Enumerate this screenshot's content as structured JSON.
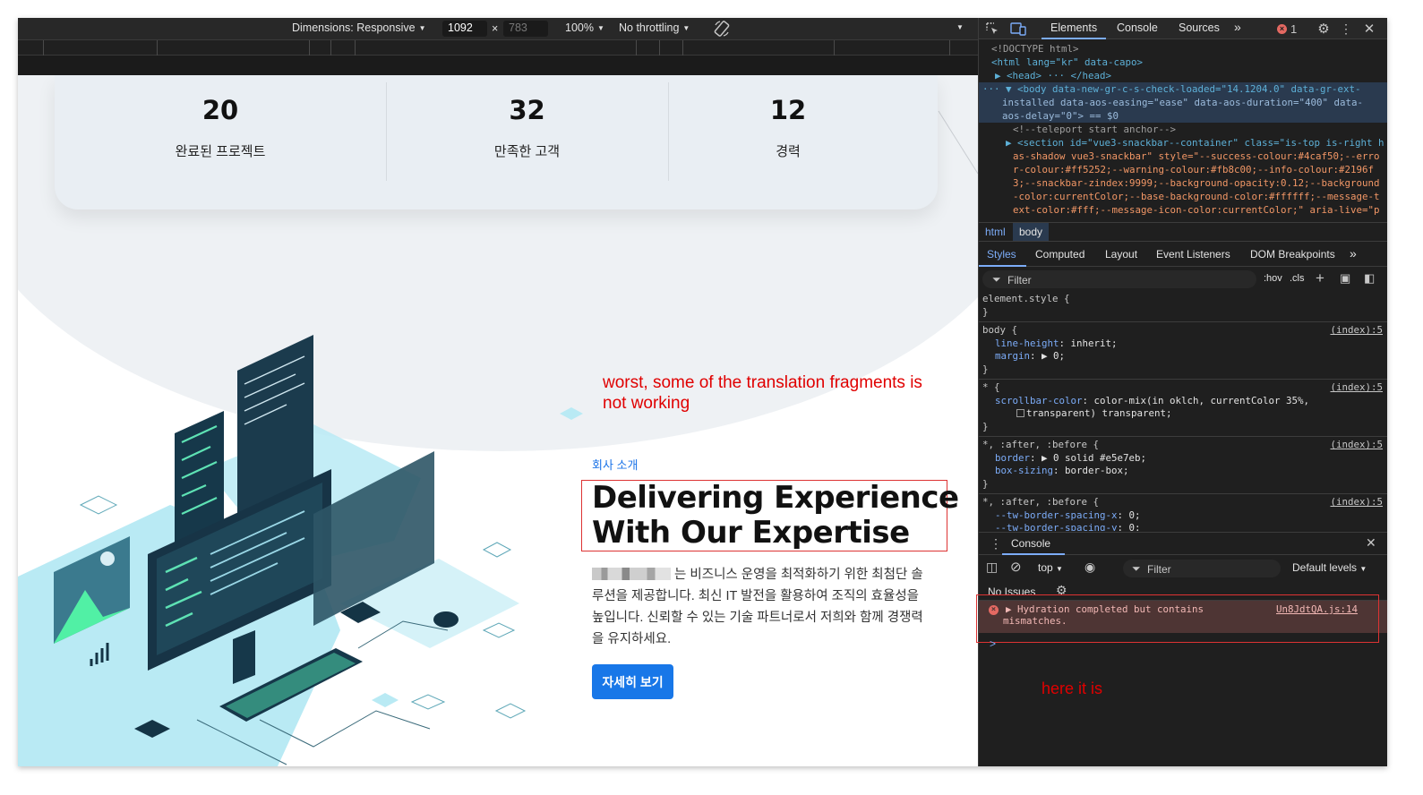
{
  "device_toolbar": {
    "dimensions_label": "Dimensions: Responsive",
    "width": "1092",
    "height": "783",
    "times": "×",
    "zoom": "100%",
    "throttling": "No throttling"
  },
  "stats": [
    {
      "number": "20",
      "label": "완료된 프로젝트"
    },
    {
      "number": "32",
      "label": "만족한 고객"
    },
    {
      "number": "12",
      "label": "경력"
    }
  ],
  "annotations": {
    "left_note": "worst, some of the translation fragments is not working",
    "right_note": "here it is"
  },
  "about": {
    "section_label": "회사 소개",
    "heading_line1": "Delivering Experience",
    "heading_line2": "With Our Expertise",
    "description": "는 비즈니스 운영을 최적화하기 위한 최첨단 솔루션을 제공합니다. 최신 IT 발전을 활용하여 조직의 효율성을 높입니다. 신뢰할 수 있는 기술 파트너로서 저희와 함께 경쟁력을 유지하세요.",
    "cta": "자세히 보기"
  },
  "devtools": {
    "tabs": [
      "Elements",
      "Console",
      "Sources",
      "»"
    ],
    "error_count": "1",
    "dom_lines": [
      {
        "text": "<!DOCTYPE html>"
      },
      {
        "text": "<html lang=\"kr\" data-capo>"
      },
      {
        "text": "▶ <head> ··· </head>"
      },
      {
        "text": "··· ▼ <body data-new-gr-c-s-check-loaded=\"14.1204.0\" data-gr-ext-"
      },
      {
        "text": "installed data-aos-easing=\"ease\" data-aos-duration=\"400\" data-"
      },
      {
        "text": "aos-delay=\"0\"> == $0"
      },
      {
        "text": "<!--teleport start anchor-->"
      },
      {
        "text": "▶ <section id=\"vue3-snackbar--container\" class=\"is-top is-right h"
      },
      {
        "text": "as-shadow vue3-snackbar\" style=\"--success-colour:#4caf50;--erro"
      },
      {
        "text": "r-colour:#ff5252;--warning-colour:#fb8c00;--info-colour:#2196f"
      },
      {
        "text": "3;--snackbar-zindex:9999;--background-opacity:0.12;--background"
      },
      {
        "text": "-color:currentColor;--base-background-color:#ffffff;--message-t"
      },
      {
        "text": "ext-color:#fff;--message-icon-color:currentColor;\" aria-live=\"p"
      }
    ],
    "breadcrumbs": [
      "html",
      "body"
    ],
    "style_tabs": [
      "Styles",
      "Computed",
      "Layout",
      "Event Listeners",
      "DOM Breakpoints",
      "»"
    ],
    "filter_placeholder": "Filter",
    "hov": ":hov",
    "cls": ".cls",
    "style_rules": [
      {
        "selector": "element.style {",
        "props": [],
        "close": "}",
        "source": ""
      },
      {
        "selector": "body {",
        "props": [
          [
            "line-height",
            "inherit;"
          ],
          [
            "margin",
            "▶ 0;"
          ]
        ],
        "close": "}",
        "source": "(index):5"
      },
      {
        "selector": "* {",
        "props": [
          [
            "scrollbar-color",
            "color-mix(in oklch, currentColor 35%,"
          ],
          [
            "",
            "transparent) transparent;"
          ]
        ],
        "close": "}",
        "source": "(index):5"
      },
      {
        "selector": "*, :after, :before {",
        "props": [
          [
            "border",
            "▶ 0 solid #e5e7eb;"
          ],
          [
            "box-sizing",
            "border-box;"
          ]
        ],
        "close": "}",
        "source": "(index):5"
      },
      {
        "selector": "*, :after, :before {",
        "props": [
          [
            "--tw-border-spacing-x",
            "0;"
          ],
          [
            "--tw-border-spacing-y",
            "0;"
          ]
        ],
        "close": "",
        "source": "(index):5"
      }
    ],
    "console": {
      "tab": "Console",
      "context": "top",
      "filter": "Filter",
      "levels": "Default levels",
      "issues": "No Issues",
      "error_line1": "▶ Hydration completed but contains",
      "error_line2": "mismatches.",
      "error_source": "Un8JdtQA.js:14",
      "prompt": ">"
    }
  },
  "colors": {
    "accent_blue": "#1877e8",
    "annotation_red": "#e00000",
    "devtools_bg": "#1f1f1f"
  }
}
